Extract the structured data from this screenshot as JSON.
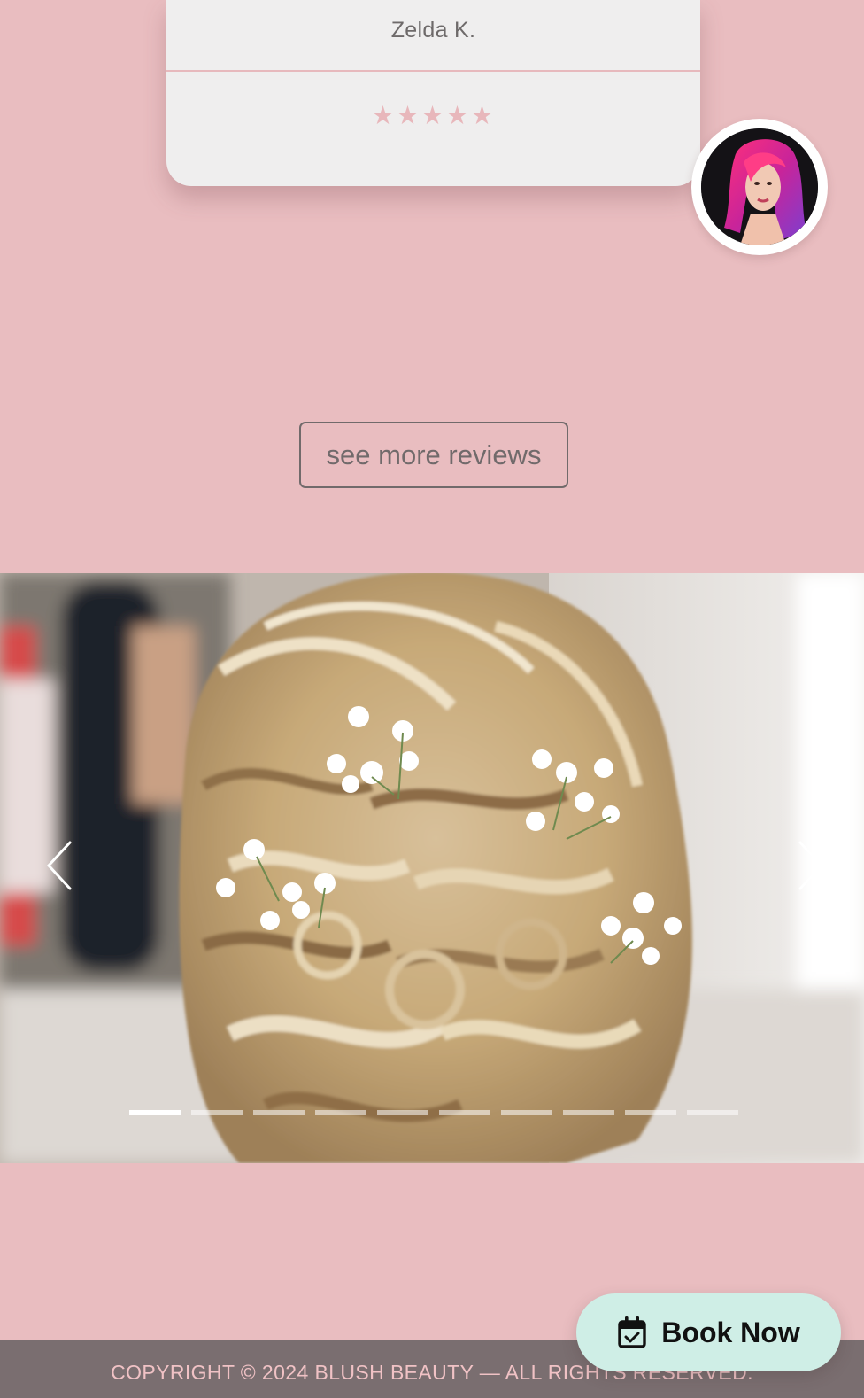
{
  "review": {
    "reviewer_name": "Zelda K.",
    "rating": "★★★★★",
    "stars": 5
  },
  "reviews_link": {
    "label": "see more reviews"
  },
  "gallery": {
    "slide_count": 10,
    "active_slide": 1,
    "prev_icon": "chevron-left-icon",
    "next_icon": "chevron-right-icon"
  },
  "book_now": {
    "label": "Book Now",
    "icon": "calendar-check-icon"
  },
  "footer": {
    "copyright": "COPYRIGHT © 2024 BLUSH BEAUTY — ALL RIGHTS RESERVED."
  },
  "colors": {
    "page_bg": "#e9bdc0",
    "card_bg": "#efeeee",
    "star": "#e8b7bb",
    "footer_bg": "#7a6e70",
    "footer_text": "#f0c2c5",
    "cta_bg": "#cfeee6"
  }
}
